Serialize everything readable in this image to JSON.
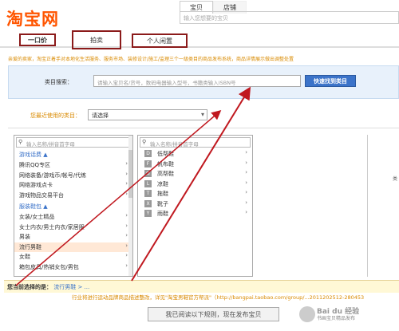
{
  "logo": "淘宝网",
  "search": {
    "tabs": [
      "宝贝",
      "店铺"
    ],
    "placeholder": "输入您想要的宝贝"
  },
  "type_tabs": [
    "一口价",
    "拍卖",
    "个人闲置"
  ],
  "notice": "亲爱的卖家，淘宝正着手对本地化生活服务、服务市场、装修设计/施工/监理三个一级类目的商品发布系统，商品详情展示做出调整处置",
  "category_search": {
    "label": "类目搜索：",
    "placeholder": "请输入宝贝名/货号，数码电器输入型号，书籍类输入ISBN号",
    "button": "快速找到类目"
  },
  "recent": {
    "label": "您最近使用的类目：",
    "value": "请选择"
  },
  "col1": {
    "placeholder": "输入名称/拼音首字母",
    "group1": "游戏话费 ▲",
    "items1": [
      "腾讯QQ专区",
      "网络装备/游戏币/帐号/代练",
      "网络游戏点卡",
      "游戏物品交易平台"
    ],
    "group2": "服装鞋包 ▲",
    "items2": [
      "女装/女士精品",
      "女士内衣/男士内衣/家居服",
      "男装",
      "流行男鞋",
      "女鞋",
      "箱包皮具/热销女包/男包"
    ]
  },
  "col2": {
    "placeholder": "输入名称/拼音首字母",
    "items": [
      {
        "letter": "D",
        "label": "低帮鞋"
      },
      {
        "letter": "F",
        "label": "帆布鞋"
      },
      {
        "letter": "G",
        "label": "高帮鞋"
      },
      {
        "letter": "L",
        "label": "凉鞋"
      },
      {
        "letter": "T",
        "label": "拖鞋"
      },
      {
        "letter": "X",
        "label": "靴子"
      },
      {
        "letter": "Y",
        "label": "雨鞋"
      }
    ]
  },
  "col4_text": "类",
  "chosen": {
    "label": "您当前选择的是：",
    "value": "流行男鞋 > ..."
  },
  "rule_note": "行业将进行运动品牌商品描述整改，详见\"淘宝男鞋官方帮派\"（http://bangpai.taobao.com/group/...2011202512-280453",
  "publish_button": "我已阅读以下规则，现在发布宝贝",
  "watermark": {
    "big": "Bai du 经验",
    "small": "书画宝贝精品发布"
  },
  "colors": {
    "logo": "#ff5500",
    "accent": "#3b73c9",
    "annotation": "#8b1a1a",
    "notice": "#d98a00"
  }
}
